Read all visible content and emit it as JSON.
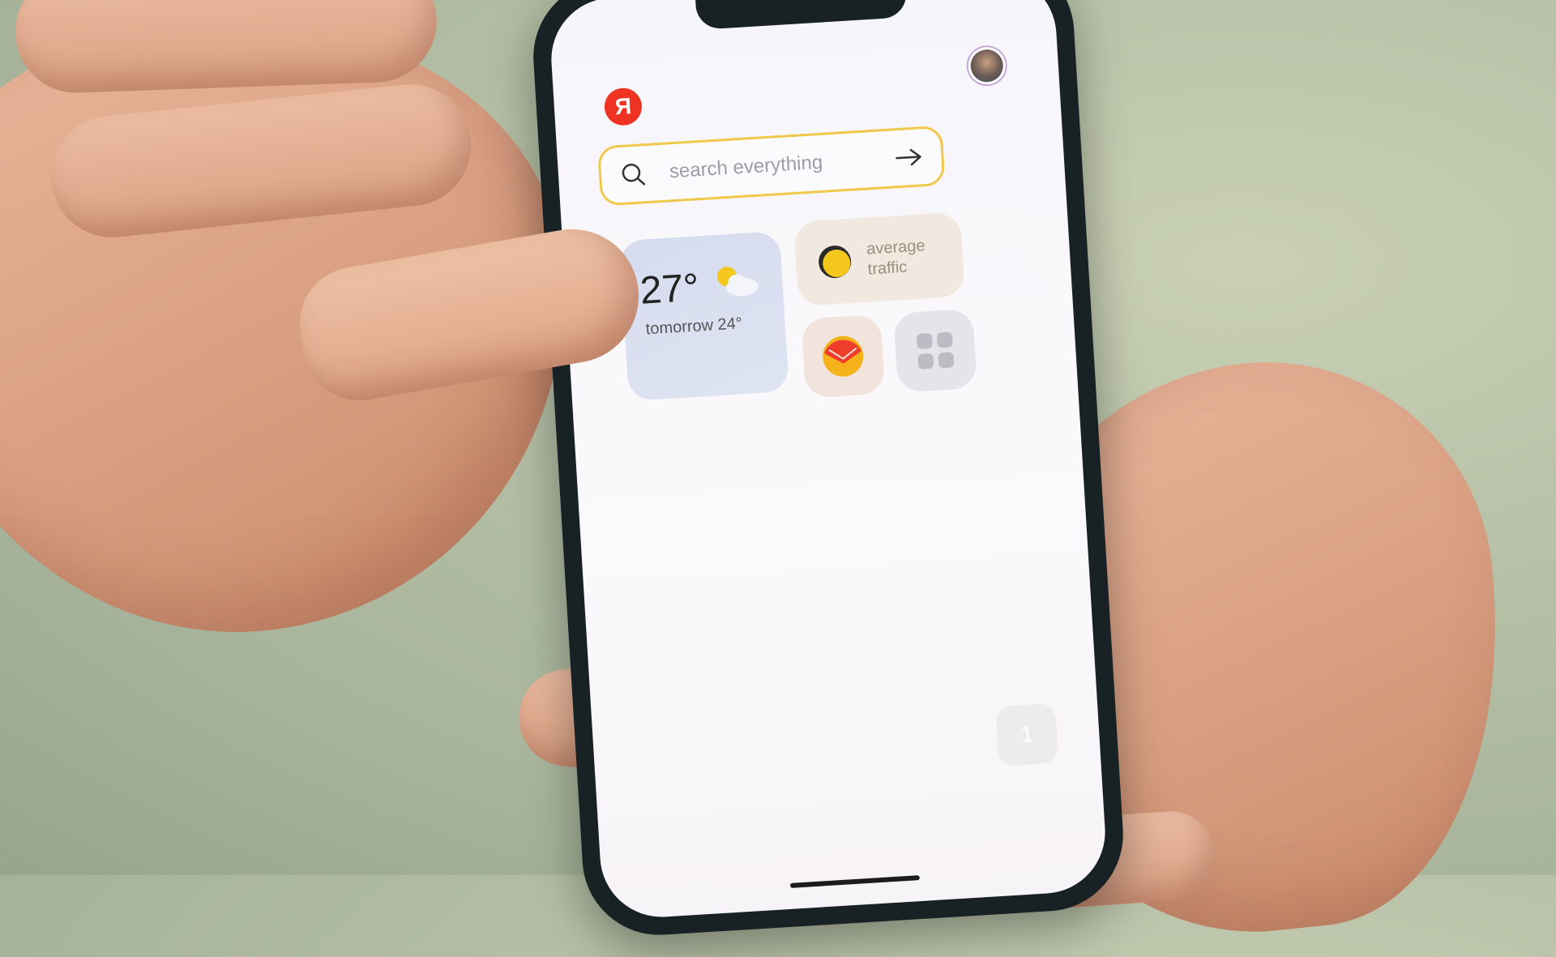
{
  "brand": {
    "logo_letter": "Я",
    "logo_color": "#ee3322",
    "accent": "#f0c84a"
  },
  "search": {
    "placeholder": "search everything",
    "icon": "search-icon",
    "submit_icon": "arrow-right-icon"
  },
  "widgets": {
    "weather": {
      "temperature": "27°",
      "tomorrow": "tomorrow 24°",
      "icon": "partly-cloudy-icon"
    },
    "traffic": {
      "line1": "average",
      "line2": "traffic",
      "icon": "traffic-light-icon"
    },
    "mail": {
      "icon": "mail-envelope-icon"
    },
    "all_apps": {
      "icon": "grid-apps-icon"
    }
  },
  "page_indicator": {
    "value": "1"
  },
  "profile": {
    "icon": "avatar"
  }
}
